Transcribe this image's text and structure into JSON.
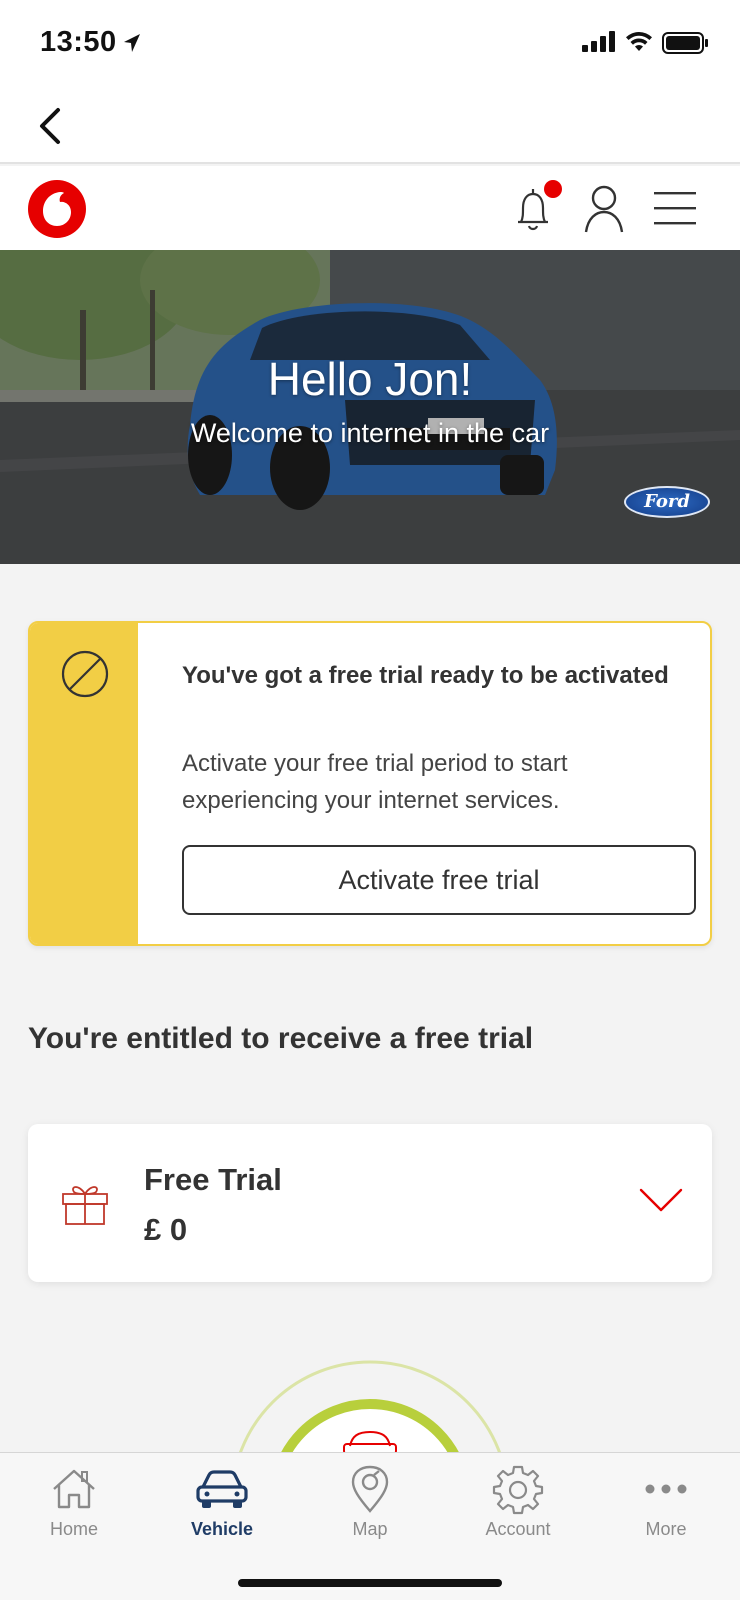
{
  "status_bar": {
    "time": "13:50"
  },
  "hero": {
    "title": "Hello Jon!",
    "subtitle": "Welcome to internet in the car",
    "brand_logo": "Ford"
  },
  "trial_card": {
    "title": "You've got a free trial ready to be activated",
    "description": "Activate your free trial period to start experiencing your internet services.",
    "button_label": "Activate free trial"
  },
  "entitled_heading": "You're entitled to receive a free trial",
  "offer": {
    "name": "Free Trial",
    "price": "£ 0"
  },
  "tabs": [
    {
      "label": "Home",
      "icon": "home-icon"
    },
    {
      "label": "Vehicle",
      "icon": "car-icon",
      "active": true
    },
    {
      "label": "Map",
      "icon": "map-pin-icon"
    },
    {
      "label": "Account",
      "icon": "gear-icon"
    },
    {
      "label": "More",
      "icon": "more-icon"
    }
  ],
  "colors": {
    "brand_red": "#e60000",
    "accent_yellow": "#f2ce45",
    "active_tab": "#1f3c66",
    "gauge_green": "#b8cf3c"
  }
}
